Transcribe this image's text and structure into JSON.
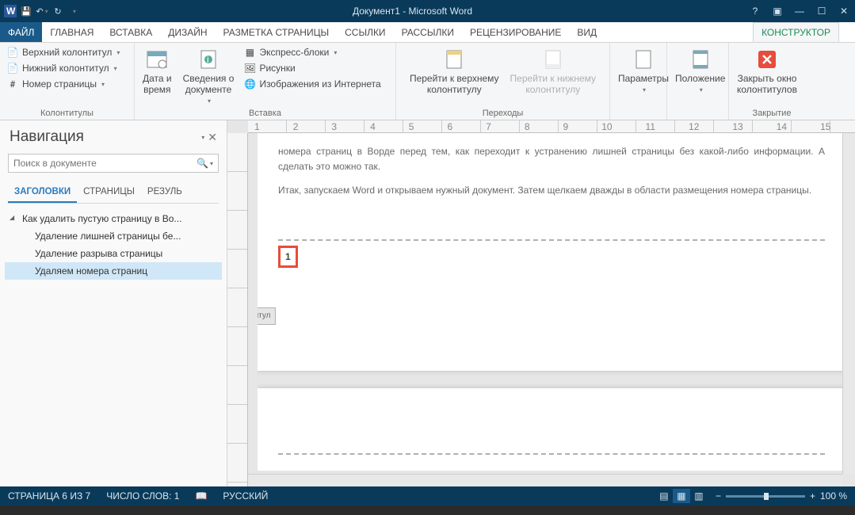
{
  "title": "Документ1 - Microsoft Word",
  "tabs": {
    "file": "ФАЙЛ",
    "home": "ГЛАВНАЯ",
    "insert": "ВСТАВКА",
    "design": "ДИЗАЙН",
    "layout": "РАЗМЕТКА СТРАНИЦЫ",
    "references": "ССЫЛКИ",
    "mailings": "РАССЫЛКИ",
    "review": "РЕЦЕНЗИРОВАНИЕ",
    "view": "ВИД",
    "designer": "КОНСТРУКТОР"
  },
  "ribbon": {
    "headers_group": {
      "title": "Колонтитулы",
      "header": "Верхний колонтитул",
      "footer": "Нижний колонтитул",
      "pagenum": "Номер страницы"
    },
    "insert_group": {
      "title": "Вставка",
      "date": "Дата и\nвремя",
      "docinfo": "Сведения о\nдокументе",
      "quick": "Экспресс-блоки",
      "pics": "Рисунки",
      "webpics": "Изображения из Интернета"
    },
    "nav_group": {
      "title": "Переходы",
      "up": "Перейти к верхнему\nколонтитулу",
      "down": "Перейти к нижнему\nколонтитулу"
    },
    "params": "Параметры",
    "position": "Положение",
    "close_group": {
      "title": "Закрытие",
      "close": "Закрыть окно\nколонтитулов"
    }
  },
  "nav": {
    "title": "Навигация",
    "search_ph": "Поиск в документе",
    "tabs": {
      "headings": "ЗАГОЛОВКИ",
      "pages": "СТРАНИЦЫ",
      "results": "РЕЗУЛЬ"
    },
    "tree": [
      "Как удалить пустую страницу в Во...",
      "Удаление лишней страницы бе...",
      "Удаление разрыва страницы",
      "Удаляем номера страниц"
    ]
  },
  "doc": {
    "para1": "номера страниц в Ворде перед тем, как переходит к устранению лишней страницы без какой-либо информации. А сделать это можно так.",
    "para2": "Итак, запускаем Word и открываем нужный документ. Затем щелкаем дважды в области размещения номера страницы.",
    "footer_tag": "титул",
    "page_number": "1"
  },
  "status": {
    "page": "СТРАНИЦА 6 ИЗ 7",
    "words": "ЧИСЛО СЛОВ: 1",
    "lang": "РУССКИЙ",
    "zoom": "100 %"
  }
}
